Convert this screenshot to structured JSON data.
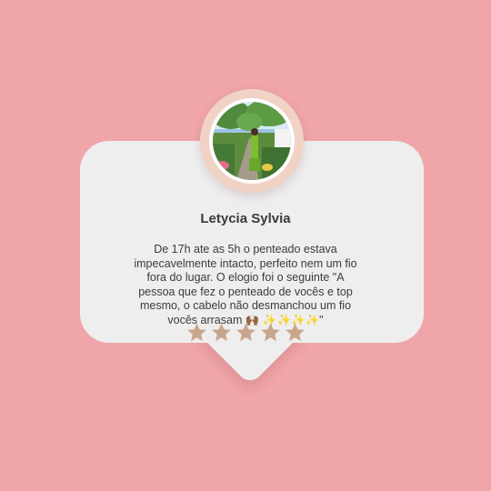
{
  "testimonial": {
    "name": "Letycia Sylvia",
    "review": "De 17h ate as 5h o penteado estava impecavelmente intacto, perfeito nem um fio fora do lugar. O elogio foi o seguinte \"A pessoa que fez o penteado de vocês e top mesmo, o cabelo não desmanchou um fio vocês arrasam 🙌🏾 ✨✨✨✨\"",
    "rating": 5,
    "rating_max": 5
  },
  "colors": {
    "background": "#f0a5a8",
    "card": "#eeeeef",
    "star": "#c8a68c",
    "avatar_ring": "#f1d3c5"
  },
  "icons": {
    "star": "star-icon"
  }
}
